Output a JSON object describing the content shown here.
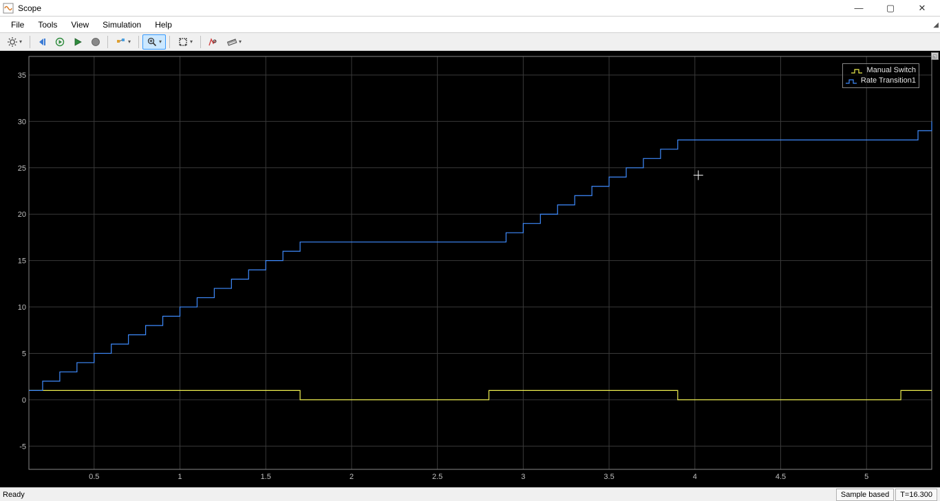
{
  "window": {
    "title": "Scope",
    "min_tooltip": "Minimize",
    "max_tooltip": "Maximize",
    "close_tooltip": "Close"
  },
  "menu": {
    "items": [
      "File",
      "Tools",
      "View",
      "Simulation",
      "Help"
    ]
  },
  "toolbar": {
    "icons": [
      "settings-gear-icon",
      "step-back-icon",
      "step-forward-icon",
      "run-icon",
      "stop-icon",
      "highlight-icon",
      "zoom-in-icon",
      "pan-icon",
      "cursor-icon",
      "measure-icon"
    ]
  },
  "legend": {
    "series": [
      {
        "name": "Manual Switch",
        "color": "#f0f050"
      },
      {
        "name": "Rate Transition1",
        "color": "#3f8cff"
      }
    ]
  },
  "status": {
    "ready": "Ready",
    "mode": "Sample based",
    "time": "T=16.300"
  },
  "chart_data": {
    "type": "line",
    "xlabel": "",
    "ylabel": "",
    "xlim": [
      0.12,
      5.38
    ],
    "ylim": [
      -7.5,
      37.0
    ],
    "x_ticks": [
      0.5,
      1,
      1.5,
      2,
      2.5,
      3,
      3.5,
      4,
      4.5,
      5
    ],
    "y_ticks": [
      -5,
      0,
      5,
      10,
      15,
      20,
      25,
      30,
      35
    ],
    "cursor": {
      "x": 4.02,
      "y": 24.2
    },
    "series": [
      {
        "name": "Manual Switch",
        "color": "#f0f050",
        "style": "step",
        "x": [
          0.12,
          1.7,
          2.8,
          3.9,
          5.2,
          5.38
        ],
        "y": [
          1.0,
          0.0,
          1.0,
          0.0,
          1.0,
          1.0
        ]
      },
      {
        "name": "Rate Transition1",
        "color": "#3f8cff",
        "style": "step",
        "x": [
          0.12,
          0.2,
          0.3,
          0.4,
          0.5,
          0.6,
          0.7,
          0.8,
          0.9,
          1.0,
          1.1,
          1.2,
          1.3,
          1.4,
          1.5,
          1.6,
          1.7,
          2.8,
          2.9,
          3.0,
          3.1,
          3.2,
          3.3,
          3.4,
          3.5,
          3.6,
          3.7,
          3.8,
          3.9,
          5.2,
          5.3,
          5.38
        ],
        "y": [
          1,
          2,
          3,
          4,
          5,
          6,
          7,
          8,
          9,
          10,
          11,
          12,
          13,
          14,
          15,
          16,
          17,
          17,
          18,
          19,
          20,
          21,
          22,
          23,
          24,
          25,
          26,
          27,
          28,
          28,
          29,
          30
        ]
      }
    ]
  }
}
